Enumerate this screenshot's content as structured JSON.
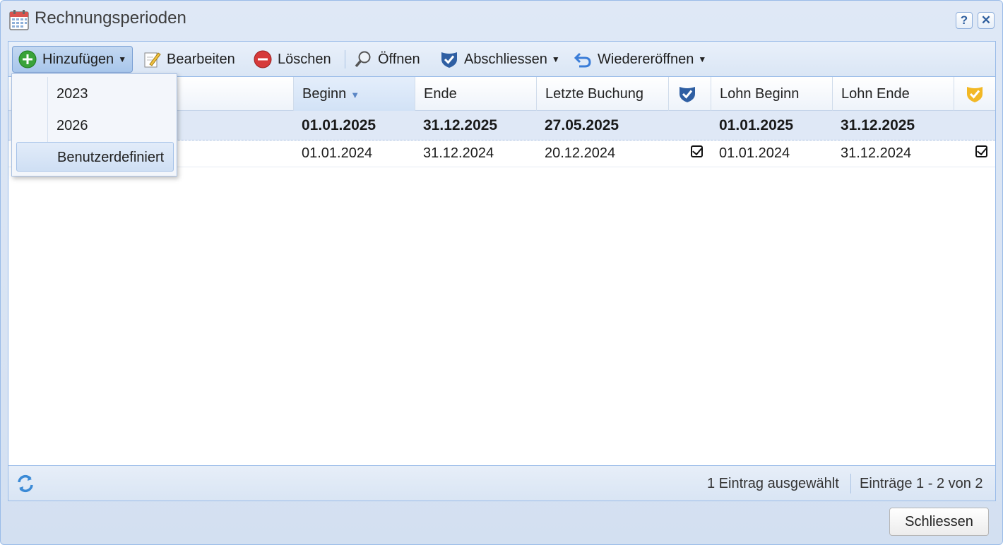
{
  "window": {
    "title": "Rechnungsperioden",
    "help_label": "?",
    "close_label": "✕"
  },
  "toolbar": {
    "add": "Hinzufügen",
    "edit": "Bearbeiten",
    "delete": "Löschen",
    "open": "Öffnen",
    "close_period": "Abschliessen",
    "reopen": "Wiedereröffnen"
  },
  "add_menu": {
    "items": [
      "2023",
      "2026",
      "Benutzerdefiniert"
    ],
    "highlighted": "Benutzerdefiniert"
  },
  "columns": {
    "begin": "Beginn",
    "end": "Ende",
    "last_booking": "Letzte Buchung",
    "closed_icon": "shield-check-icon",
    "payroll_begin": "Lohn Beginn",
    "payroll_end": "Lohn Ende",
    "payroll_closed_icon": "shield-check-gold-icon"
  },
  "rows": [
    {
      "begin": "01.01.2025",
      "end": "31.12.2025",
      "last_booking": "27.05.2025",
      "closed": false,
      "payroll_begin": "01.01.2025",
      "payroll_end": "31.12.2025",
      "payroll_closed": false,
      "selected": true
    },
    {
      "begin": "01.01.2024",
      "end": "31.12.2024",
      "last_booking": "20.12.2024",
      "closed": true,
      "payroll_begin": "01.01.2024",
      "payroll_end": "31.12.2024",
      "payroll_closed": true,
      "selected": false
    }
  ],
  "status": {
    "selection": "1 Eintrag ausgewählt",
    "paging": "Einträge 1 - 2 von 2"
  },
  "footer": {
    "close_button": "Schliessen"
  },
  "colors": {
    "accent": "#99bbe8",
    "selected_row": "#dfe8f6",
    "shield_blue": "#2f5fa3",
    "shield_gold": "#f2b825",
    "add_green": "#3aa33a",
    "delete_red": "#d63a3a"
  }
}
